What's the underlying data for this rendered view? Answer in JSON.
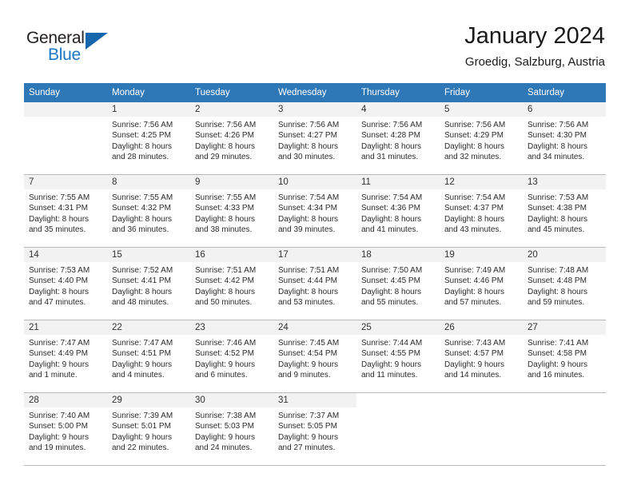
{
  "brand": {
    "name_top": "General",
    "name_bottom": "Blue",
    "accent_color": "#1b76c4",
    "triangle_color": "#1566ad"
  },
  "header": {
    "month_title": "January 2024",
    "location": "Groedig, Salzburg, Austria"
  },
  "theme": {
    "header_row_bg": "#2e78b8",
    "daynum_band_bg": "#f2f2f2",
    "grid_line": "#b9b9b9",
    "text": "#2b2b2b"
  },
  "weekday_headers": [
    "Sunday",
    "Monday",
    "Tuesday",
    "Wednesday",
    "Thursday",
    "Friday",
    "Saturday"
  ],
  "weeks": [
    [
      {
        "day": "",
        "sunrise": "",
        "sunset": "",
        "daylight_line1": "",
        "daylight_line2": "",
        "empty": true
      },
      {
        "day": "1",
        "sunrise": "Sunrise: 7:56 AM",
        "sunset": "Sunset: 4:25 PM",
        "daylight_line1": "Daylight: 8 hours",
        "daylight_line2": "and 28 minutes."
      },
      {
        "day": "2",
        "sunrise": "Sunrise: 7:56 AM",
        "sunset": "Sunset: 4:26 PM",
        "daylight_line1": "Daylight: 8 hours",
        "daylight_line2": "and 29 minutes."
      },
      {
        "day": "3",
        "sunrise": "Sunrise: 7:56 AM",
        "sunset": "Sunset: 4:27 PM",
        "daylight_line1": "Daylight: 8 hours",
        "daylight_line2": "and 30 minutes."
      },
      {
        "day": "4",
        "sunrise": "Sunrise: 7:56 AM",
        "sunset": "Sunset: 4:28 PM",
        "daylight_line1": "Daylight: 8 hours",
        "daylight_line2": "and 31 minutes."
      },
      {
        "day": "5",
        "sunrise": "Sunrise: 7:56 AM",
        "sunset": "Sunset: 4:29 PM",
        "daylight_line1": "Daylight: 8 hours",
        "daylight_line2": "and 32 minutes."
      },
      {
        "day": "6",
        "sunrise": "Sunrise: 7:56 AM",
        "sunset": "Sunset: 4:30 PM",
        "daylight_line1": "Daylight: 8 hours",
        "daylight_line2": "and 34 minutes."
      }
    ],
    [
      {
        "day": "7",
        "sunrise": "Sunrise: 7:55 AM",
        "sunset": "Sunset: 4:31 PM",
        "daylight_line1": "Daylight: 8 hours",
        "daylight_line2": "and 35 minutes."
      },
      {
        "day": "8",
        "sunrise": "Sunrise: 7:55 AM",
        "sunset": "Sunset: 4:32 PM",
        "daylight_line1": "Daylight: 8 hours",
        "daylight_line2": "and 36 minutes."
      },
      {
        "day": "9",
        "sunrise": "Sunrise: 7:55 AM",
        "sunset": "Sunset: 4:33 PM",
        "daylight_line1": "Daylight: 8 hours",
        "daylight_line2": "and 38 minutes."
      },
      {
        "day": "10",
        "sunrise": "Sunrise: 7:54 AM",
        "sunset": "Sunset: 4:34 PM",
        "daylight_line1": "Daylight: 8 hours",
        "daylight_line2": "and 39 minutes."
      },
      {
        "day": "11",
        "sunrise": "Sunrise: 7:54 AM",
        "sunset": "Sunset: 4:36 PM",
        "daylight_line1": "Daylight: 8 hours",
        "daylight_line2": "and 41 minutes."
      },
      {
        "day": "12",
        "sunrise": "Sunrise: 7:54 AM",
        "sunset": "Sunset: 4:37 PM",
        "daylight_line1": "Daylight: 8 hours",
        "daylight_line2": "and 43 minutes."
      },
      {
        "day": "13",
        "sunrise": "Sunrise: 7:53 AM",
        "sunset": "Sunset: 4:38 PM",
        "daylight_line1": "Daylight: 8 hours",
        "daylight_line2": "and 45 minutes."
      }
    ],
    [
      {
        "day": "14",
        "sunrise": "Sunrise: 7:53 AM",
        "sunset": "Sunset: 4:40 PM",
        "daylight_line1": "Daylight: 8 hours",
        "daylight_line2": "and 47 minutes."
      },
      {
        "day": "15",
        "sunrise": "Sunrise: 7:52 AM",
        "sunset": "Sunset: 4:41 PM",
        "daylight_line1": "Daylight: 8 hours",
        "daylight_line2": "and 48 minutes."
      },
      {
        "day": "16",
        "sunrise": "Sunrise: 7:51 AM",
        "sunset": "Sunset: 4:42 PM",
        "daylight_line1": "Daylight: 8 hours",
        "daylight_line2": "and 50 minutes."
      },
      {
        "day": "17",
        "sunrise": "Sunrise: 7:51 AM",
        "sunset": "Sunset: 4:44 PM",
        "daylight_line1": "Daylight: 8 hours",
        "daylight_line2": "and 53 minutes."
      },
      {
        "day": "18",
        "sunrise": "Sunrise: 7:50 AM",
        "sunset": "Sunset: 4:45 PM",
        "daylight_line1": "Daylight: 8 hours",
        "daylight_line2": "and 55 minutes."
      },
      {
        "day": "19",
        "sunrise": "Sunrise: 7:49 AM",
        "sunset": "Sunset: 4:46 PM",
        "daylight_line1": "Daylight: 8 hours",
        "daylight_line2": "and 57 minutes."
      },
      {
        "day": "20",
        "sunrise": "Sunrise: 7:48 AM",
        "sunset": "Sunset: 4:48 PM",
        "daylight_line1": "Daylight: 8 hours",
        "daylight_line2": "and 59 minutes."
      }
    ],
    [
      {
        "day": "21",
        "sunrise": "Sunrise: 7:47 AM",
        "sunset": "Sunset: 4:49 PM",
        "daylight_line1": "Daylight: 9 hours",
        "daylight_line2": "and 1 minute."
      },
      {
        "day": "22",
        "sunrise": "Sunrise: 7:47 AM",
        "sunset": "Sunset: 4:51 PM",
        "daylight_line1": "Daylight: 9 hours",
        "daylight_line2": "and 4 minutes."
      },
      {
        "day": "23",
        "sunrise": "Sunrise: 7:46 AM",
        "sunset": "Sunset: 4:52 PM",
        "daylight_line1": "Daylight: 9 hours",
        "daylight_line2": "and 6 minutes."
      },
      {
        "day": "24",
        "sunrise": "Sunrise: 7:45 AM",
        "sunset": "Sunset: 4:54 PM",
        "daylight_line1": "Daylight: 9 hours",
        "daylight_line2": "and 9 minutes."
      },
      {
        "day": "25",
        "sunrise": "Sunrise: 7:44 AM",
        "sunset": "Sunset: 4:55 PM",
        "daylight_line1": "Daylight: 9 hours",
        "daylight_line2": "and 11 minutes."
      },
      {
        "day": "26",
        "sunrise": "Sunrise: 7:43 AM",
        "sunset": "Sunset: 4:57 PM",
        "daylight_line1": "Daylight: 9 hours",
        "daylight_line2": "and 14 minutes."
      },
      {
        "day": "27",
        "sunrise": "Sunrise: 7:41 AM",
        "sunset": "Sunset: 4:58 PM",
        "daylight_line1": "Daylight: 9 hours",
        "daylight_line2": "and 16 minutes."
      }
    ],
    [
      {
        "day": "28",
        "sunrise": "Sunrise: 7:40 AM",
        "sunset": "Sunset: 5:00 PM",
        "daylight_line1": "Daylight: 9 hours",
        "daylight_line2": "and 19 minutes."
      },
      {
        "day": "29",
        "sunrise": "Sunrise: 7:39 AM",
        "sunset": "Sunset: 5:01 PM",
        "daylight_line1": "Daylight: 9 hours",
        "daylight_line2": "and 22 minutes."
      },
      {
        "day": "30",
        "sunrise": "Sunrise: 7:38 AM",
        "sunset": "Sunset: 5:03 PM",
        "daylight_line1": "Daylight: 9 hours",
        "daylight_line2": "and 24 minutes."
      },
      {
        "day": "31",
        "sunrise": "Sunrise: 7:37 AM",
        "sunset": "Sunset: 5:05 PM",
        "daylight_line1": "Daylight: 9 hours",
        "daylight_line2": "and 27 minutes."
      },
      {
        "day": "",
        "sunrise": "",
        "sunset": "",
        "daylight_line1": "",
        "daylight_line2": "",
        "empty": true,
        "blank": true
      },
      {
        "day": "",
        "sunrise": "",
        "sunset": "",
        "daylight_line1": "",
        "daylight_line2": "",
        "empty": true,
        "blank": true
      },
      {
        "day": "",
        "sunrise": "",
        "sunset": "",
        "daylight_line1": "",
        "daylight_line2": "",
        "empty": true,
        "blank": true
      }
    ]
  ]
}
